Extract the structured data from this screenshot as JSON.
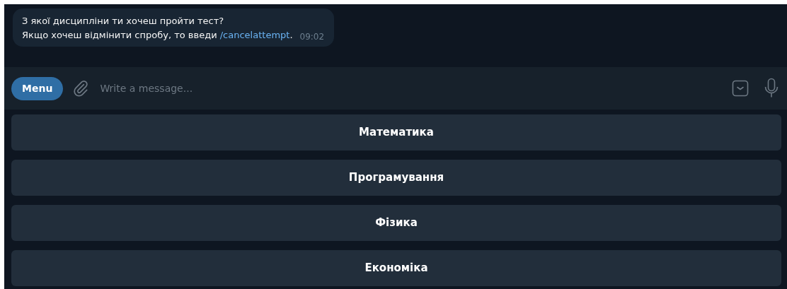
{
  "message": {
    "line_1": "З якої дисципліни ти хочеш пройти тест?",
    "line_2_before_link": "Якщо хочеш відмінити спробу, то введи ",
    "link": "/cancelattempt",
    "line_2_after_link": ".",
    "time": "09:02"
  },
  "composer": {
    "menu_button": "Menu",
    "placeholder": "Write a message..."
  },
  "keyboard_buttons": [
    {
      "label": "Математика"
    },
    {
      "label": "Програмування"
    },
    {
      "label": "Фізика"
    },
    {
      "label": "Економіка"
    }
  ]
}
